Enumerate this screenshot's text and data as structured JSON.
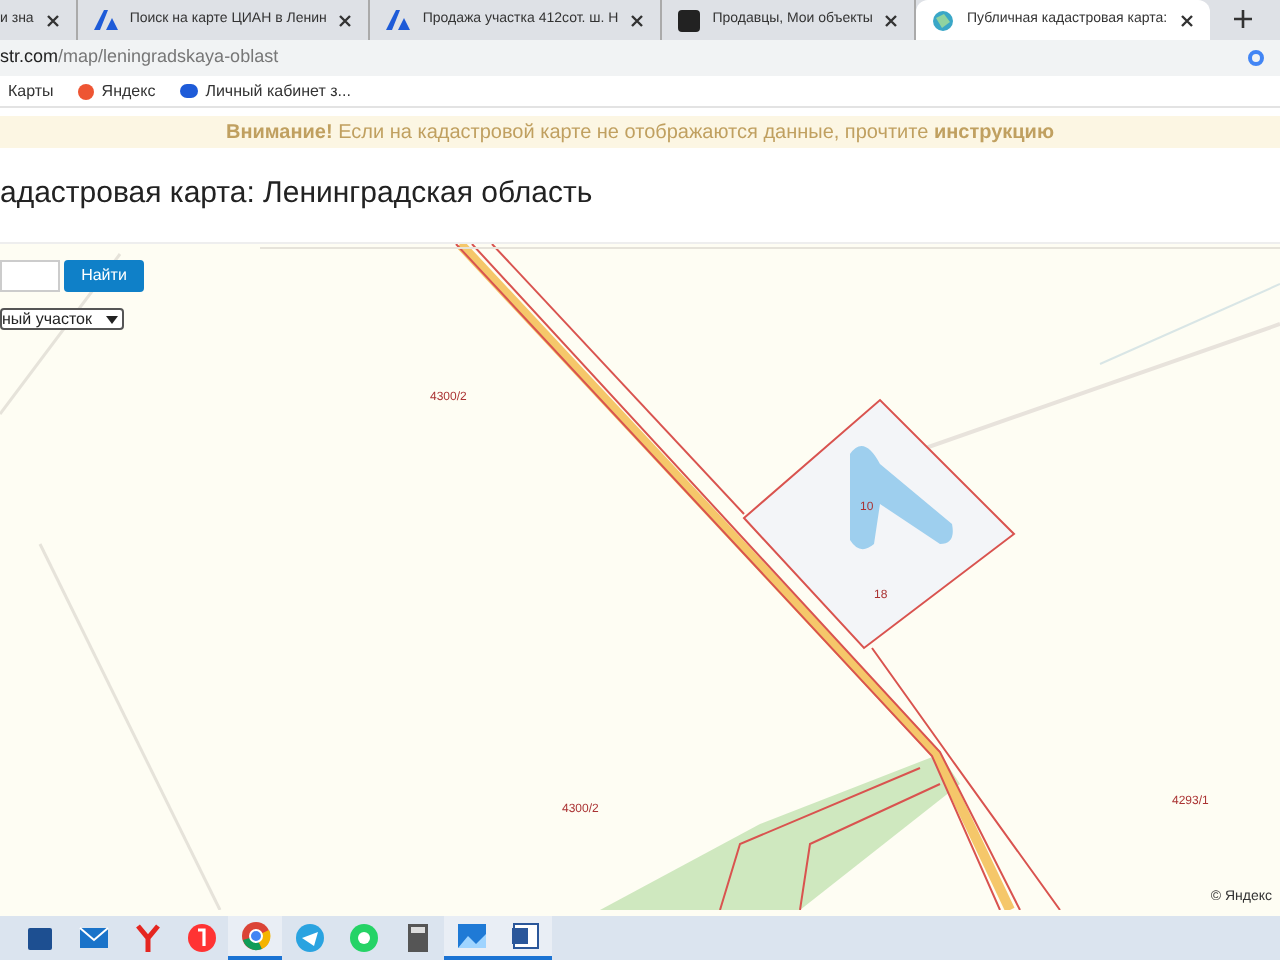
{
  "browser": {
    "tabs": [
      {
        "title": "и зна",
        "kind": "plain",
        "selected": false
      },
      {
        "title": "Поиск на карте ЦИАН в Ленин",
        "kind": "brand",
        "selected": false
      },
      {
        "title": "Продажа участка 412сот. ш. Н",
        "kind": "brand",
        "selected": false
      },
      {
        "title": "Продавцы, Мои объекты",
        "kind": "square",
        "selected": false
      },
      {
        "title": "Публичная кадастровая карта:",
        "kind": "globe",
        "selected": true
      }
    ],
    "address": {
      "host": "str.com",
      "path": "/map/leningradskaya-oblast"
    },
    "bookmarks": [
      {
        "label": "Карты",
        "kind": "plain"
      },
      {
        "label": "Яндекс",
        "kind": "yandex"
      },
      {
        "label": "Личный кабинет з...",
        "kind": "chat"
      }
    ]
  },
  "notice": "**Внимание!** Если на кадастровой карте не отображаются данные, прочтите **инструкцию**",
  "page_title": "адастровая карта: Ленинградская область",
  "search": {
    "button": "Найти",
    "type_select": "ный участок"
  },
  "map": {
    "labels": [
      "4300/2",
      "10",
      "18",
      "4300/2",
      "4293/1"
    ],
    "copyright": "© Яндекс"
  },
  "taskbar": {
    "apps": [
      {
        "kind": "store",
        "open": false
      },
      {
        "kind": "mail",
        "open": false
      },
      {
        "kind": "yabrowser",
        "open": false
      },
      {
        "kind": "yandex",
        "open": false
      },
      {
        "kind": "chrome",
        "open": true
      },
      {
        "kind": "telegram",
        "open": false
      },
      {
        "kind": "whatsapp",
        "open": false
      },
      {
        "kind": "calculator",
        "open": false
      },
      {
        "kind": "photos",
        "open": true
      },
      {
        "kind": "word",
        "open": true
      }
    ]
  }
}
